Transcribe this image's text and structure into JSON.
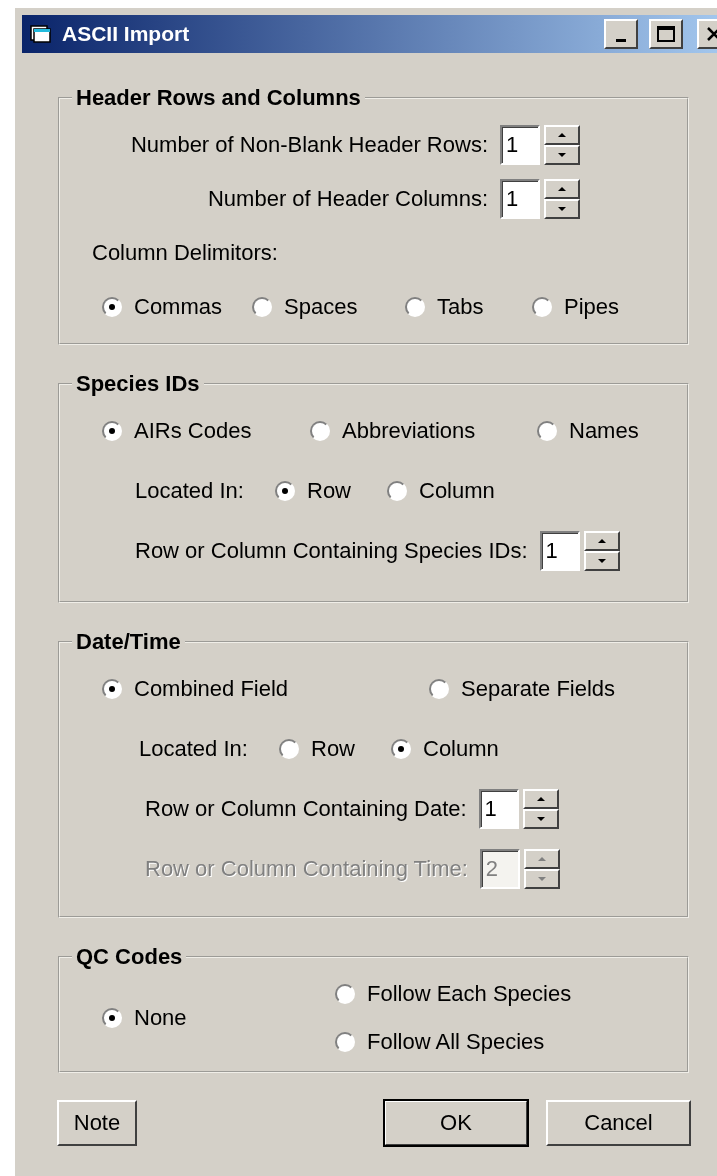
{
  "window": {
    "title": "ASCII Import"
  },
  "groups": [
    {
      "title": "Header Rows and Columns",
      "rows": [
        {
          "kind": "spinner",
          "label": "Number of Non-Blank Header Rows:",
          "value": "1",
          "disabled": false
        },
        {
          "kind": "spinner",
          "label": "Number of Header Columns:",
          "value": "1",
          "disabled": false
        },
        {
          "kind": "label",
          "text": "Column Delimitors:"
        },
        {
          "kind": "radios",
          "options": [
            {
              "label": "Commas",
              "selected": true
            },
            {
              "label": "Spaces",
              "selected": false
            },
            {
              "label": "Tabs",
              "selected": false
            },
            {
              "label": "Pipes",
              "selected": false
            }
          ]
        }
      ]
    },
    {
      "title": "Species IDs",
      "rows": [
        {
          "kind": "radios",
          "options": [
            {
              "label": "AIRs Codes",
              "selected": true
            },
            {
              "label": "Abbreviations",
              "selected": false
            },
            {
              "label": "Names",
              "selected": false
            }
          ]
        },
        {
          "kind": "located",
          "label": "Located In:",
          "options": [
            {
              "label": "Row",
              "selected": true
            },
            {
              "label": "Column",
              "selected": false
            }
          ]
        },
        {
          "kind": "spinner",
          "label": "Row or Column Containing Species IDs:",
          "value": "1",
          "disabled": false
        }
      ]
    },
    {
      "title": "Date/Time",
      "rows": [
        {
          "kind": "radios",
          "options": [
            {
              "label": "Combined Field",
              "selected": true
            },
            {
              "label": "Separate Fields",
              "selected": false
            }
          ]
        },
        {
          "kind": "located",
          "label": "Located In:",
          "options": [
            {
              "label": "Row",
              "selected": false
            },
            {
              "label": "Column",
              "selected": true
            }
          ]
        },
        {
          "kind": "spinner",
          "label": "Row or Column Containing Date:",
          "value": "1",
          "disabled": false
        },
        {
          "kind": "spinner",
          "label": "Row or Column Containing Time:",
          "value": "2",
          "disabled": true
        }
      ]
    },
    {
      "title": "QC Codes",
      "rows": [
        {
          "kind": "radios",
          "options": [
            {
              "label": "None",
              "selected": true
            },
            {
              "label": "Follow Each Species",
              "selected": false
            },
            {
              "label": "Follow All Species",
              "selected": false
            }
          ]
        }
      ]
    }
  ],
  "buttons": [
    {
      "label": "Note",
      "default": false
    },
    {
      "label": "OK",
      "default": true
    },
    {
      "label": "Cancel",
      "default": false
    }
  ]
}
